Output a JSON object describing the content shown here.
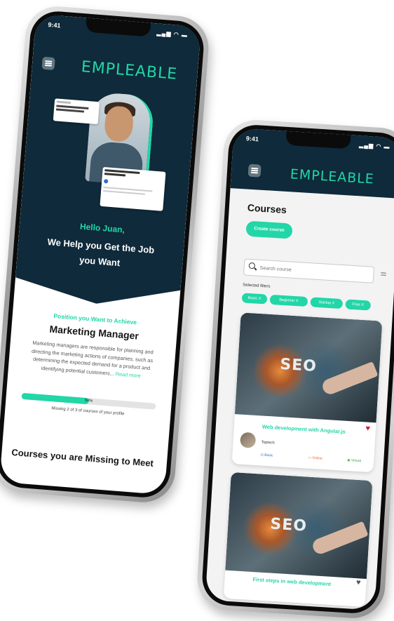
{
  "brand": {
    "name": "EMPLEABLE",
    "accent": "#22d6a7",
    "dark": "#0f2a3a"
  },
  "status": {
    "time": "9:41"
  },
  "home": {
    "greeting": "Hello Juan,",
    "tagline": "We Help you Get the Job you Want",
    "position_label": "Position you Want to Achieve",
    "position_title": "Marketing Manager",
    "position_desc": "Marketing managers are responsible for planning and directing the marketing actions of companies, such as determining the expected demand for a product and identifying potential customers...",
    "read_more": "Read more",
    "progress_pct": 50,
    "progress_label": "50%",
    "missing_note": "Missing 2 of 3 of courses of your profile",
    "courses_missing_title": "Courses you are Missing to Meet"
  },
  "courses": {
    "title": "Courses",
    "create_label": "Create course",
    "search_placeholder": "Search course",
    "selected_filters_label": "Selected filters",
    "filters": [
      "Basic X",
      "Beginner X",
      "Startup X",
      "Free X"
    ],
    "items": [
      {
        "title": "Web development with Angular.js",
        "provider": "Toptech",
        "meta": [
          "Basic",
          "Online",
          "Virtual"
        ],
        "image_text": "SEO",
        "favorite": true
      },
      {
        "title": "First steps in web development",
        "image_text": "SEO",
        "favorite": true
      }
    ]
  }
}
